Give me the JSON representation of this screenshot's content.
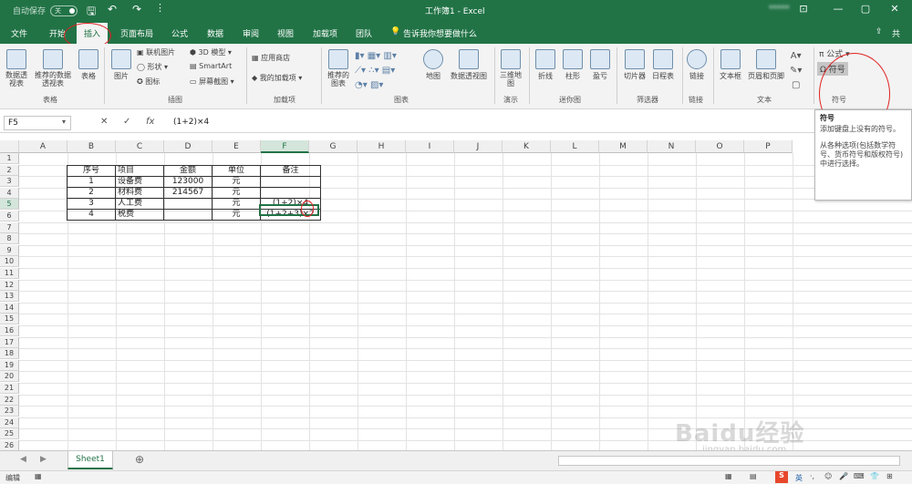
{
  "titlebar": {
    "autosave_label": "自动保存",
    "autosave_state": "关",
    "title": "工作簿1 - Excel",
    "user": "*****",
    "buttons": {
      "restore": "⊡",
      "minimize": "—",
      "maximize": "▢",
      "close": "✕"
    }
  },
  "tabs": [
    "文件",
    "开始",
    "插入",
    "页面布局",
    "公式",
    "数据",
    "审阅",
    "视图",
    "加载项",
    "团队"
  ],
  "tell_me": "告诉我你想要做什么",
  "share_label": "共",
  "active_tab": "插入",
  "ribbon": {
    "pivot_table": "数据透视表",
    "recommended_pivot": "推荐的数据透视表",
    "table": "表格",
    "group_tables": "表格",
    "picture": "图片",
    "online_picture": "联机图片",
    "shapes": "形状",
    "icons": "图标",
    "model3d": "3D 模型",
    "smartart": "SmartArt",
    "screenshot": "屏幕截图",
    "group_illustrations": "插图",
    "app_store": "应用商店",
    "my_addins": "我的加载项",
    "group_addins": "加载项",
    "recommended_charts": "推荐的图表",
    "group_charts": "图表",
    "map": "地图",
    "pivot_chart": "数据透视图",
    "map3d": "三维地图",
    "group_tours": "演示",
    "line": "折线",
    "column": "柱形",
    "win_loss": "盈亏",
    "group_sparklines": "迷你图",
    "slicer": "切片器",
    "timeline": "日程表",
    "group_filters": "筛选器",
    "link": "链接",
    "group_links": "链接",
    "textbox": "文本框",
    "header_footer": "页眉和页脚",
    "group_text": "文本",
    "equation": "公式",
    "symbol": "符号",
    "group_symbols": "符号"
  },
  "formula_bar": {
    "name_box": "F5",
    "cancel": "✕",
    "enter": "✓",
    "fx": "fx",
    "value": "(1+2)×4"
  },
  "columns": [
    "A",
    "B",
    "C",
    "D",
    "E",
    "F",
    "G",
    "H",
    "I",
    "J",
    "K",
    "L",
    "M",
    "N",
    "O",
    "P"
  ],
  "rows": [
    "1",
    "2",
    "3",
    "4",
    "5",
    "6",
    "7",
    "8",
    "9",
    "10",
    "11",
    "12",
    "13",
    "14",
    "15",
    "16",
    "17",
    "18",
    "19",
    "20",
    "21",
    "22",
    "23",
    "24",
    "25",
    "26"
  ],
  "table": {
    "headers": [
      "序号",
      "项目",
      "金额",
      "单位",
      "备注"
    ],
    "rows": [
      [
        "1",
        "设备费",
        "123000",
        "元",
        ""
      ],
      [
        "2",
        "材料费",
        "214567",
        "元",
        ""
      ],
      [
        "3",
        "人工费",
        "",
        "元",
        "(1+2)×4"
      ],
      [
        "4",
        "税费",
        "",
        "元",
        "(1+2+3)×2"
      ]
    ]
  },
  "tooltip": {
    "title": "符号",
    "line1": "添加键盘上没有的符号。",
    "line2": "从各种选项(包括数学符号、货币符号和版权符号)中进行选择。"
  },
  "sheet_tab": "Sheet1",
  "status": {
    "mode": "编辑",
    "ime_label": "英"
  },
  "watermark": "Baidu经验",
  "watermark_url": "jingyan.baidu.com",
  "colors": {
    "excel_green": "#217346",
    "annotation_red": "#e02020"
  }
}
